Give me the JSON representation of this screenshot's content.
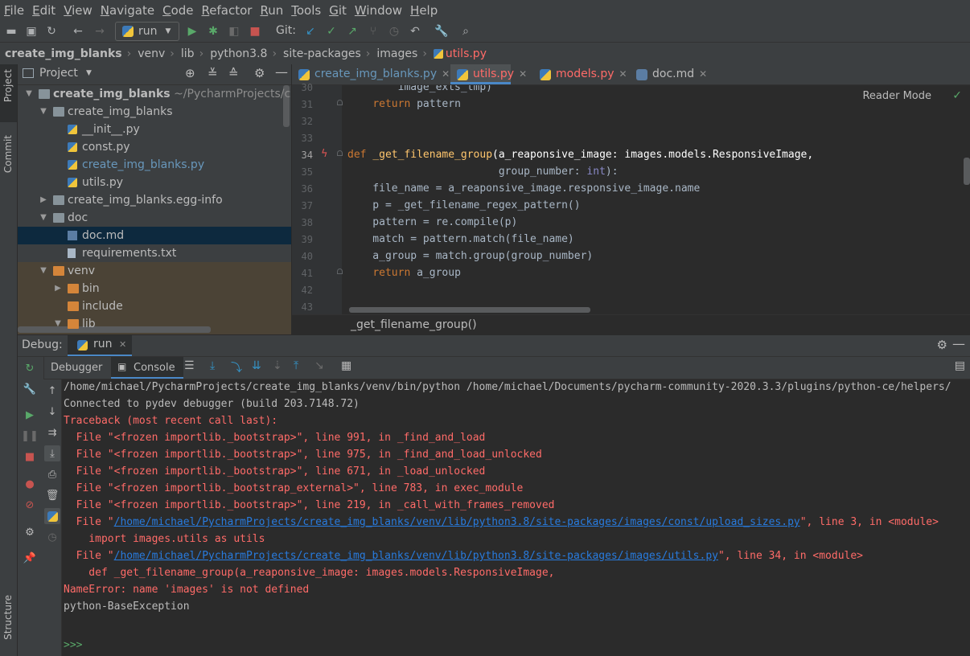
{
  "menu": [
    "File",
    "Edit",
    "View",
    "Navigate",
    "Code",
    "Refactor",
    "Run",
    "Tools",
    "Git",
    "Window",
    "Help"
  ],
  "toolbar": {
    "run_config": "run",
    "git_label": "Git:"
  },
  "breadcrumbs": [
    "create_img_blanks",
    "venv",
    "lib",
    "python3.8",
    "site-packages",
    "images",
    "utils.py"
  ],
  "left_strip": {
    "project": "Project",
    "commit": "Commit",
    "structure": "Structure"
  },
  "project_panel": {
    "title": "Project",
    "tree": [
      {
        "label": "create_img_blanks",
        "extra": "~/PycharmProjects/cre",
        "level": 0,
        "arrow": "open",
        "icon": "folder"
      },
      {
        "label": "create_img_blanks",
        "level": 1,
        "arrow": "open",
        "icon": "folder"
      },
      {
        "label": "__init__.py",
        "level": 2,
        "icon": "py"
      },
      {
        "label": "const.py",
        "level": 2,
        "icon": "py"
      },
      {
        "label": "create_img_blanks.py",
        "level": 2,
        "icon": "py",
        "modified": true
      },
      {
        "label": "utils.py",
        "level": 2,
        "icon": "py"
      },
      {
        "label": "create_img_blanks.egg-info",
        "level": 1,
        "arrow": "closed",
        "icon": "folder"
      },
      {
        "label": "doc",
        "level": 1,
        "arrow": "open",
        "icon": "folder"
      },
      {
        "label": "doc.md",
        "level": 2,
        "icon": "md",
        "selected": true
      },
      {
        "label": "requirements.txt",
        "level": 2,
        "icon": "txt"
      },
      {
        "label": "venv",
        "level": 1,
        "arrow": "open",
        "icon": "folder-o"
      },
      {
        "label": "bin",
        "level": 2,
        "arrow": "closed",
        "icon": "folder-o"
      },
      {
        "label": "include",
        "level": 2,
        "icon": "folder-o"
      },
      {
        "label": "lib",
        "level": 2,
        "arrow": "open",
        "icon": "folder-o"
      }
    ]
  },
  "editor_tabs": [
    {
      "label": "create_img_blanks.py",
      "color": "#6897bb"
    },
    {
      "label": "utils.py",
      "color": "#ff6b68",
      "active": true
    },
    {
      "label": "models.py",
      "color": "#ff6b68"
    },
    {
      "label": "doc.md",
      "color": "#bbbbbb"
    }
  ],
  "editor": {
    "reader_mode": "Reader Mode",
    "lines": [
      {
        "n": "30",
        "code": "        image_exts_tmp)"
      },
      {
        "n": "31",
        "code": "    return pattern"
      },
      {
        "n": "32",
        "code": ""
      },
      {
        "n": "33",
        "code": ""
      },
      {
        "n": "34",
        "code": "def _get_filename_group(a_reaponsive_image: images.models.ResponsiveImage,"
      },
      {
        "n": "35",
        "code": "                        group_number: int):"
      },
      {
        "n": "36",
        "code": "    file_name = a_reaponsive_image.responsive_image.name"
      },
      {
        "n": "37",
        "code": "    p = _get_filename_regex_pattern()"
      },
      {
        "n": "38",
        "code": "    pattern = re.compile(p)"
      },
      {
        "n": "39",
        "code": "    match = pattern.match(file_name)"
      },
      {
        "n": "40",
        "code": "    a_group = match.group(group_number)"
      },
      {
        "n": "41",
        "code": "    return a_group"
      },
      {
        "n": "42",
        "code": ""
      },
      {
        "n": "43",
        "code": ""
      }
    ],
    "footer": "_get_filename_group()"
  },
  "debug": {
    "label": "Debug:",
    "run_tab": "run",
    "tabs": [
      "Debugger",
      "Console"
    ]
  },
  "console": {
    "lines": [
      {
        "text": "/home/michael/PycharmProjects/create_img_blanks/venv/bin/python /home/michael/Documents/pycharm-community-2020.3.3/plugins/python-ce/helpers/",
        "cls": ""
      },
      {
        "text": "Connected to pydev debugger (build 203.7148.72)",
        "cls": ""
      },
      {
        "text": "Traceback (most recent call last):",
        "cls": "err"
      },
      {
        "text": "  File \"<frozen importlib._bootstrap>\", line 991, in _find_and_load",
        "cls": "err"
      },
      {
        "text": "  File \"<frozen importlib._bootstrap>\", line 975, in _find_and_load_unlocked",
        "cls": "err"
      },
      {
        "text": "  File \"<frozen importlib._bootstrap>\", line 671, in _load_unlocked",
        "cls": "err"
      },
      {
        "text": "  File \"<frozen importlib._bootstrap_external>\", line 783, in exec_module",
        "cls": "err"
      },
      {
        "text": "  File \"<frozen importlib._bootstrap>\", line 219, in _call_with_frames_removed",
        "cls": "err"
      },
      {
        "pre": "  File \"",
        "link": "/home/michael/PycharmProjects/create_img_blanks/venv/lib/python3.8/site-packages/images/const/upload_sizes.py",
        "post": "\", line 3, in <module>",
        "cls": "err"
      },
      {
        "text": "    import images.utils as utils",
        "cls": "err"
      },
      {
        "pre": "  File \"",
        "link": "/home/michael/PycharmProjects/create_img_blanks/venv/lib/python3.8/site-packages/images/utils.py",
        "post": "\", line 34, in <module>",
        "cls": "err"
      },
      {
        "text": "    def _get_filename_group(a_reaponsive_image: images.models.ResponsiveImage,",
        "cls": "err"
      },
      {
        "text": "NameError: name 'images' is not defined",
        "cls": "err"
      },
      {
        "text": "python-BaseException",
        "cls": ""
      },
      {
        "text": "",
        "cls": ""
      },
      {
        "text": ">>>",
        "cls": "prompt"
      }
    ]
  }
}
